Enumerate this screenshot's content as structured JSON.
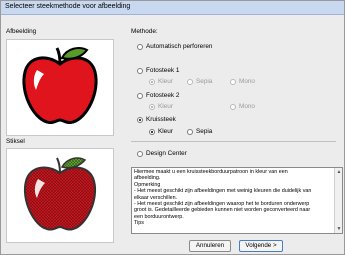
{
  "window": {
    "title": "Selecteer steekmethode voor afbeelding"
  },
  "labels": {
    "afbeelding": "Afbeelding",
    "steeksel": "Stiksel",
    "methode": "Methode:"
  },
  "methods": {
    "auto": "Automatisch perforeren",
    "foto1": "Fotosteek 1",
    "foto1_opts": {
      "kleur": "Kleur",
      "sepia": "Sepia",
      "mono": "Mono"
    },
    "foto2": "Fotosteek 2",
    "foto2_opts": {
      "kleur": "Kleur",
      "mono": "Mono"
    },
    "kruis": "Kruissteek",
    "kruis_opts": {
      "kleur": "Kleur",
      "sepia": "Sepia"
    },
    "design": "Design Center",
    "selected": "Kruissteek"
  },
  "description": {
    "lines": [
      "Hiermee maakt u een kruissteekborduurpatroon in kleur van een",
      "afbeelding.",
      "Opmerking",
      "- Het meest geschikt zijn afbeeldingen met weinig kleuren die duidelijk van",
      "elkaar verschillen.",
      "- Het meest geschikt zijn afbeeldingen waarop het te borduren onderwerp",
      "groot is. Gedetailleerde gebieden kunnen niet worden geconverteerd naar",
      "een borduurontwerp.",
      "Tips"
    ]
  },
  "buttons": {
    "cancel": "Annuleren",
    "next": "Volgende >"
  },
  "colors": {
    "apple_red": "#e0141c",
    "leaf_green": "#5a9a2a"
  }
}
